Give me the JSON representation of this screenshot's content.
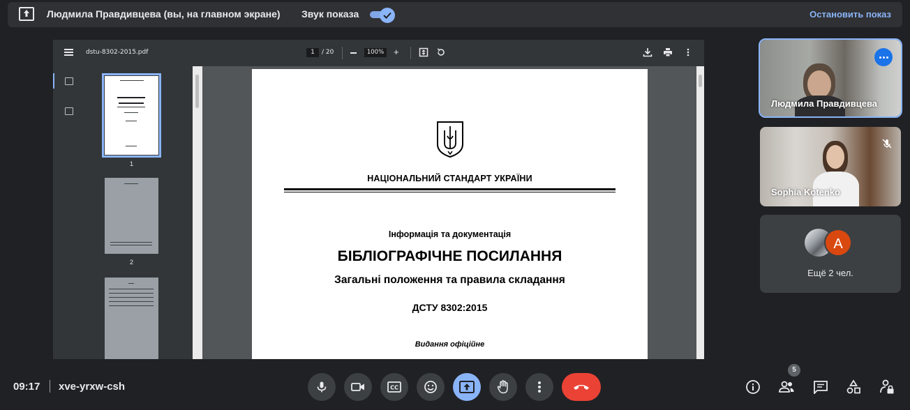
{
  "presenting_bar": {
    "presenter": "Людмила Правдивцева (вы, на главном экране)",
    "sound_label": "Звук показа",
    "sound_on": true,
    "stop_label": "Остановить показ",
    "accent": "#8ab4f8"
  },
  "pdf_viewer": {
    "file_name": "dstu-8302-2015.pdf",
    "current_page": "1",
    "total_pages": "/ 20",
    "zoom": "100%",
    "thumbnails": [
      {
        "label": "1",
        "selected": true
      },
      {
        "label": "2",
        "selected": false
      },
      {
        "label": ""
      }
    ],
    "page": {
      "heading": "НАЦІОНАЛЬНИЙ СТАНДАРТ УКРАЇНИ",
      "category": "Інформація та документація",
      "title": "БІБЛІОГРАФІЧНЕ ПОСИЛАННЯ",
      "subtitle": "Загальні положення та правила складання",
      "code": "ДСТУ  8302:2015",
      "edition": "Видання офіційне"
    }
  },
  "participants": [
    {
      "name": "Людмила Правдивцева",
      "icon": "more-options-icon"
    },
    {
      "name": "Sophia Kotenko",
      "icon": "mic-off-icon"
    }
  ],
  "others": {
    "avatar_letter": "A",
    "label": "Ещё 2 чел."
  },
  "bottom_bar": {
    "time": "09:17",
    "meeting_code": "xve-yrxw-csh",
    "participant_count": "5",
    "end_call_color": "#ea4335"
  }
}
